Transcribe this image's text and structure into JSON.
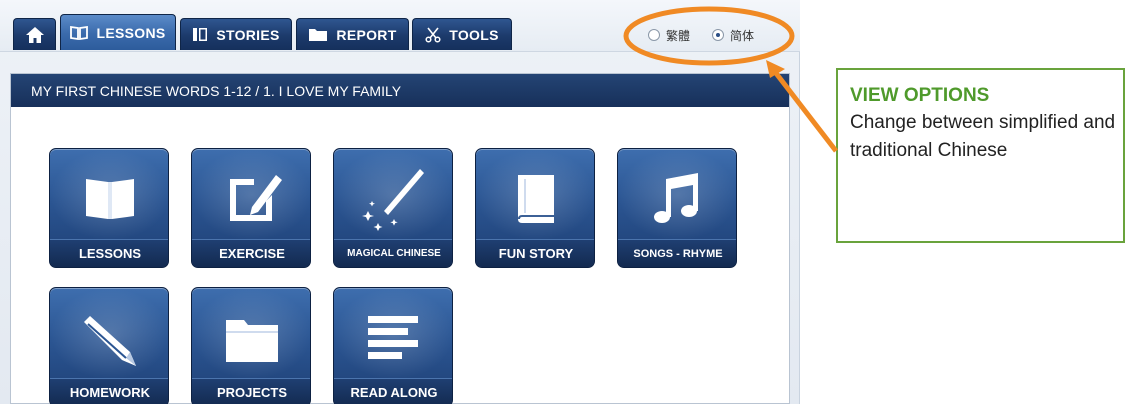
{
  "tabs": {
    "lessons": "LESSONS",
    "stories": "STORIES",
    "report": "REPORT",
    "tools": "TOOLS"
  },
  "view_options": {
    "traditional": "繁體",
    "simplified": "简体",
    "selected": "simplified"
  },
  "breadcrumb": "MY FIRST CHINESE WORDS 1-12  /  1. I LOVE MY FAMILY",
  "tiles": [
    {
      "label": "LESSONS",
      "icon": "book-icon"
    },
    {
      "label": "EXERCISE",
      "icon": "edit-icon"
    },
    {
      "label": "MAGICAL CHINESE",
      "icon": "magic-wand-icon"
    },
    {
      "label": "FUN STORY",
      "icon": "storybook-icon"
    },
    {
      "label": "SONGS - RHYME",
      "icon": "music-note-icon"
    },
    {
      "label": "HOMEWORK",
      "icon": "pencil-icon"
    },
    {
      "label": "PROJECTS",
      "icon": "folder-icon"
    },
    {
      "label": "READ ALONG",
      "icon": "text-lines-icon"
    }
  ],
  "callout": {
    "title": "VIEW OPTIONS",
    "body": "Change between simplified and traditional Chinese"
  },
  "colors": {
    "tab_blue": "#1c3a6b",
    "tile_blue": "#2b5592",
    "annotation_orange": "#f08a24",
    "callout_green": "#69a33c"
  }
}
